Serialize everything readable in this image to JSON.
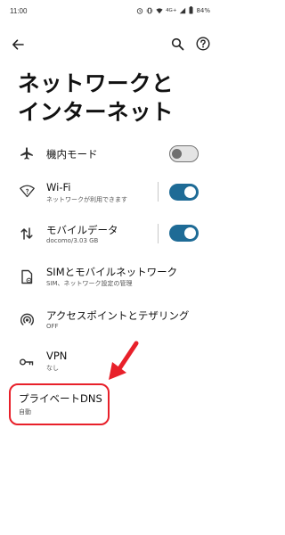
{
  "status_bar": {
    "time": "11:00",
    "network": "4G+",
    "battery": "84%"
  },
  "page": {
    "title": "ネットワークと\nインターネット"
  },
  "settings": [
    {
      "title": "機内モード",
      "subtitle": "",
      "icon": "airplane-icon",
      "toggle": "off"
    },
    {
      "title": "Wi-Fi",
      "subtitle": "ネットワークが利用できます",
      "icon": "wifi-icon",
      "toggle": "on"
    },
    {
      "title": "モバイルデータ",
      "subtitle": "docomo/3.03 GB",
      "icon": "mobile-data-icon",
      "toggle": "on"
    },
    {
      "title": "SIMとモバイルネットワーク",
      "subtitle": "SIM、ネットワーク設定の管理",
      "icon": "sim-icon",
      "toggle": ""
    },
    {
      "title": "アクセスポイントとテザリング",
      "subtitle": "OFF",
      "icon": "hotspot-icon",
      "toggle": ""
    },
    {
      "title": "VPN",
      "subtitle": "なし",
      "icon": "vpn-key-icon",
      "toggle": ""
    },
    {
      "title": "プライベートDNS",
      "subtitle": "自動",
      "icon": "",
      "toggle": ""
    }
  ],
  "colors": {
    "toggle_on": "#1e6b96",
    "highlight": "#e8202a"
  }
}
